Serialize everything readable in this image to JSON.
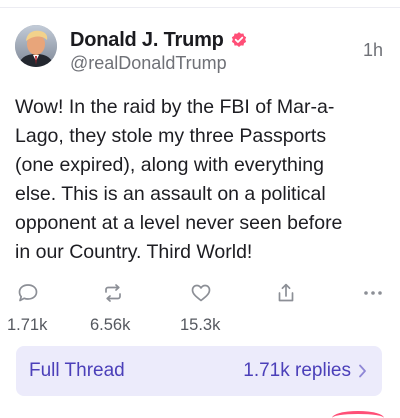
{
  "post": {
    "author": {
      "display_name": "Donald J. Trump",
      "handle": "@realDonaldTrump",
      "verified": true,
      "verified_badge_color": "#ff4f77"
    },
    "timestamp": "1h",
    "body_lines": [
      "Wow! In the raid by the FBI of Mar-a-",
      "Lago, they stole my three Passports",
      "(one expired), along with everything",
      "else. This is an assault on a political",
      "opponent at a level never seen before",
      "in our Country. Third World!"
    ]
  },
  "actions": {
    "reply": {
      "icon": "reply-icon",
      "count": "1.71k"
    },
    "retruth": {
      "icon": "retruth-icon",
      "count": "6.56k"
    },
    "like": {
      "icon": "heart-icon",
      "count": "15.3k"
    },
    "share": {
      "icon": "share-icon"
    },
    "more": {
      "icon": "more-icon"
    }
  },
  "thread": {
    "label": "Full Thread",
    "replies_label": "1.71k replies"
  },
  "colors": {
    "accent": "#4b3fb9",
    "thread_bg": "#ecebfb",
    "icon_gray": "#8c8f96",
    "text_primary": "#1d1d22",
    "text_secondary": "#6f7177"
  }
}
